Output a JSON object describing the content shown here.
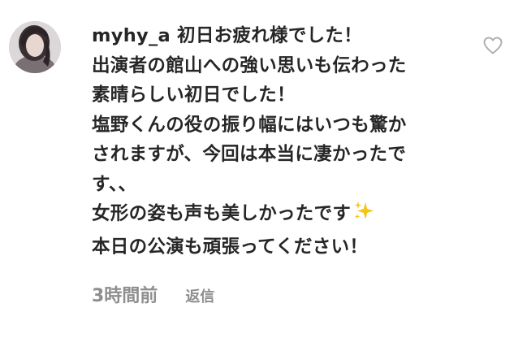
{
  "comment": {
    "username": "myhy_a",
    "lines": [
      "初日お疲れ様でした！",
      "出演者の館山への強い思いも伝わった",
      "素晴らしい初日でした！",
      "塩野くんの役の振り幅にはいつも驚か",
      "されますが、今回は本当に凄かったで",
      "す、、",
      "女形の姿も声も美しかったです",
      "本日の公演も頑張ってください！"
    ],
    "time": "3時間前",
    "reply_label": "返信"
  },
  "icons": {
    "avatar": "user-avatar",
    "like": "heart-outline-icon",
    "emoji": "sparkles-icon"
  },
  "colors": {
    "text": "#262626",
    "meta": "#8e8e8e",
    "heart_outline": "#b0b0b0",
    "sparkles": "#f5c518"
  }
}
